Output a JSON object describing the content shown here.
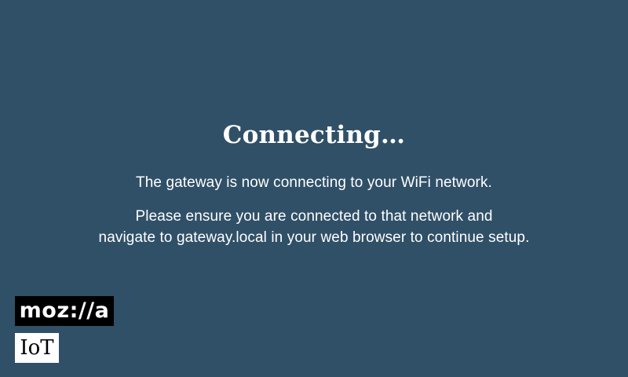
{
  "screen": {
    "background_color": "#305067",
    "text_color": "#ffffff",
    "title": "Connecting…",
    "message_1": "The gateway is now connecting to your WiFi network.",
    "message_2": "Please ensure you are connected to that network and\nnavigate to gateway.local in your web browser to continue setup."
  },
  "branding": {
    "logo_text": "moz://a",
    "product_text": "IoT"
  }
}
